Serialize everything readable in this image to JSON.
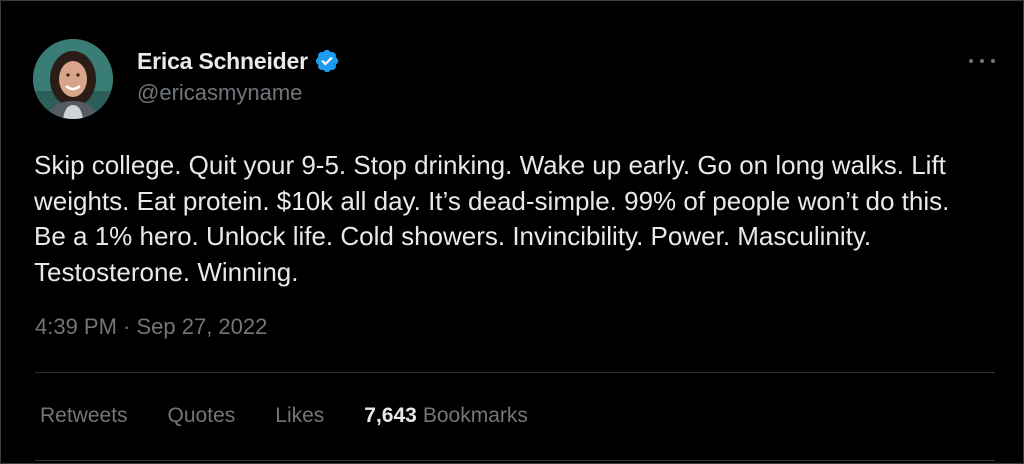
{
  "author": {
    "display_name": "Erica Schneider",
    "handle": "@ericasmyname",
    "verified": true,
    "avatar": "profile-photo"
  },
  "tweet": {
    "text": "Skip college. Quit your 9-5. Stop drinking. Wake up early. Go on long walks. Lift weights. Eat protein. $10k all day. It’s dead-simple. 99% of people won’t do this. Be a 1% hero. Unlock life. Cold showers. Invincibility. Power. Masculinity. Testosterone. Winning.",
    "timestamp": "4:39 PM · Sep 27, 2022"
  },
  "stats": {
    "retweets_label": "Retweets",
    "quotes_label": "Quotes",
    "likes_label": "Likes",
    "bookmarks_count": "7,643",
    "bookmarks_label": "Bookmarks"
  },
  "icons": {
    "verified": "verified-badge-icon",
    "more": "more-options-icon"
  },
  "colors": {
    "background": "#000000",
    "text_primary": "#e7e9ea",
    "text_secondary": "#71767b",
    "divider": "#2f3336",
    "verified_blue": "#1d9bf0"
  }
}
